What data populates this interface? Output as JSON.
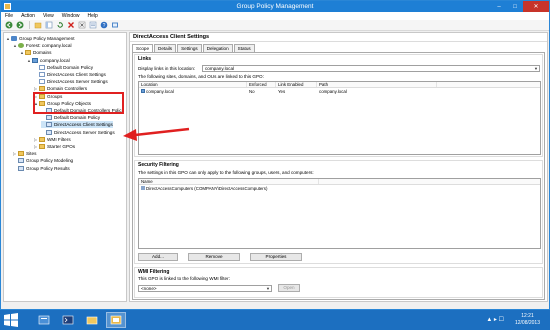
{
  "window": {
    "title": "Group Policy Management"
  },
  "menu": [
    "File",
    "Action",
    "View",
    "Window",
    "Help"
  ],
  "toolbar_icons": [
    "back-icon",
    "forward-icon",
    "up-icon",
    "show-hide-tree-icon",
    "refresh-icon",
    "delete-icon",
    "close-icon",
    "properties-icon",
    "help-icon",
    "console-icon"
  ],
  "tree": [
    {
      "label": "Group Policy Management",
      "icon": "gpm",
      "lvl": 0,
      "tw": "▲"
    },
    {
      "label": "Forest: company.local",
      "icon": "forest",
      "lvl": 1,
      "tw": "▲"
    },
    {
      "label": "Domains",
      "icon": "folder",
      "lvl": 2,
      "tw": "▲"
    },
    {
      "label": "company.local",
      "icon": "domain",
      "lvl": 3,
      "tw": "▲"
    },
    {
      "label": "Default Domain Policy",
      "icon": "gpo",
      "lvl": 4,
      "tw": ""
    },
    {
      "label": "DirectAccess Client Settings",
      "icon": "gpo",
      "lvl": 4,
      "tw": ""
    },
    {
      "label": "DirectAccess Server Settings",
      "icon": "gpo",
      "lvl": 4,
      "tw": ""
    },
    {
      "label": "Domain Controllers",
      "icon": "folder",
      "lvl": 4,
      "tw": "▷"
    },
    {
      "label": "Groups",
      "icon": "folder",
      "lvl": 4,
      "tw": "▷"
    },
    {
      "label": "Group Policy Objects",
      "icon": "folder",
      "lvl": 4,
      "tw": "▲"
    },
    {
      "label": "Default Domain Controllers Polic",
      "icon": "script",
      "lvl": 5,
      "tw": ""
    },
    {
      "label": "Default Domain Policy",
      "icon": "script",
      "lvl": 5,
      "tw": ""
    },
    {
      "label": "DirectAccess Client Settings",
      "icon": "script",
      "lvl": 5,
      "tw": ""
    },
    {
      "label": "DirectAccess Server Settings",
      "icon": "script",
      "lvl": 5,
      "tw": ""
    },
    {
      "label": "WMI Filters",
      "icon": "folder",
      "lvl": 4,
      "tw": "▷"
    },
    {
      "label": "Starter GPOs",
      "icon": "folder",
      "lvl": 4,
      "tw": "▷"
    },
    {
      "label": "Sites",
      "icon": "folder",
      "lvl": 1,
      "tw": "▷"
    },
    {
      "label": "Group Policy Modeling",
      "icon": "script",
      "lvl": 1,
      "tw": ""
    },
    {
      "label": "Group Policy Results",
      "icon": "script",
      "lvl": 1,
      "tw": ""
    }
  ],
  "detail": {
    "title": "DirectAccess Client Settings",
    "tabs": [
      "Scope",
      "Details",
      "Settings",
      "Delegation",
      "Status"
    ],
    "links": {
      "heading": "Links",
      "display_label": "Display links in this location:",
      "display_value": "company.local",
      "desc": "The following sites, domains, and OUs are linked to this GPO:",
      "columns": [
        "Location",
        "Enforced",
        "Link Enabled",
        "Path"
      ],
      "rows": [
        [
          "company.local",
          "No",
          "Yes",
          "company.local"
        ]
      ]
    },
    "security": {
      "heading": "Security Filtering",
      "desc": "The settings in this GPO can only apply to the following groups, users, and computers:",
      "column": "Name",
      "rows": [
        "DirectAccessComputers (COMPANY\\DirectAccessComputers)"
      ],
      "add": "Add...",
      "remove": "Remove",
      "properties": "Properties"
    },
    "wmi": {
      "heading": "WMI Filtering",
      "desc": "This GPO is linked to the following WMI filter:",
      "value": "<none>",
      "open": "Open"
    }
  },
  "taskbar": {
    "time": "12:21",
    "date": "12/08/2013"
  },
  "colors": {
    "highlight_box": "#e02020",
    "title_bar": "#1e7fd5",
    "taskbar": "#1c6fc0"
  }
}
